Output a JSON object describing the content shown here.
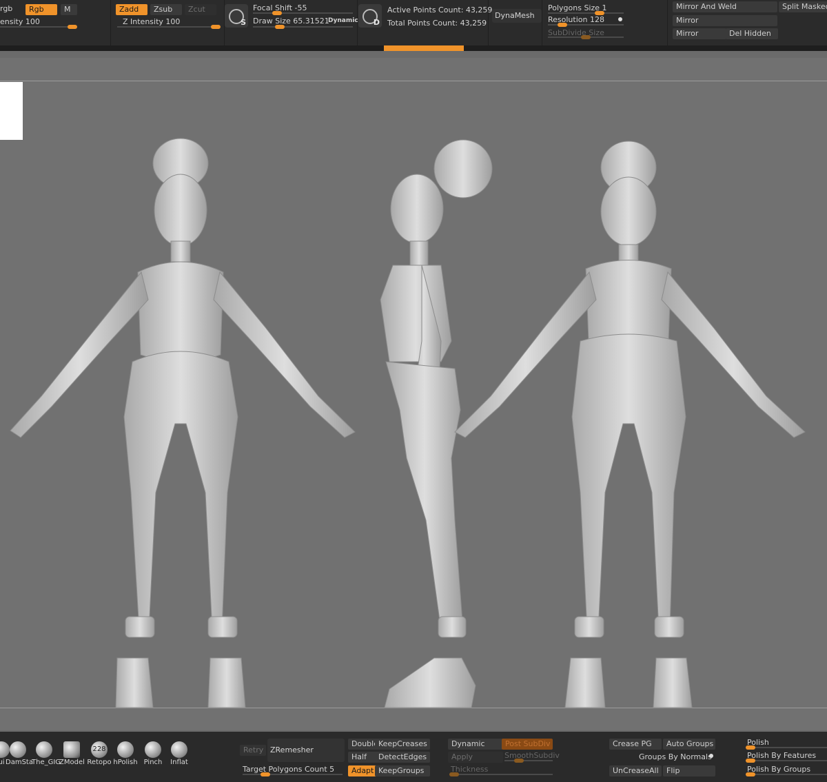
{
  "toolbar": {
    "rgb_label": "rgb",
    "rgb_toggle": "Rgb",
    "m_label": "M",
    "intensity": "ensity 100",
    "zadd": "Zadd",
    "zsub": "Zsub",
    "zcut": "Zcut",
    "z_intensity": "Z Intensity 100",
    "focal_shift": "Focal Shift -55",
    "draw_size": "Draw Size 65.31521",
    "dynamic_label": "Dynamic",
    "s_label": "S",
    "d_label": "D",
    "active_points": "Active Points Count: 43,259",
    "total_points": "Total Points Count: 43,259",
    "dynamesh": "DynaMesh",
    "polygons_size": "Polygons Size 1",
    "resolution": "Resolution 128",
    "subdivide_size": "SubDivide Size",
    "mirror_and_weld": "Mirror And Weld",
    "split_masked": "Split Masked",
    "mirror1": "Mirror",
    "mirror2": "Mirror",
    "del_hidden": "Del Hidden"
  },
  "brushes": [
    {
      "label": "ui"
    },
    {
      "label": "DamSta"
    },
    {
      "label": "The_GIG"
    },
    {
      "label": "ZModel"
    },
    {
      "label": "Retopo"
    },
    {
      "label": "hPolish"
    },
    {
      "label": "Pinch"
    },
    {
      "label": "Inflat"
    }
  ],
  "brush_badge": "228",
  "bottom": {
    "retry": "Retry",
    "zremesher": "ZRemesher",
    "target_polygons": "Target Polygons Count 5",
    "double": "Double",
    "half": "Half",
    "adapt": "Adapt",
    "keepcreases": "KeepCreases",
    "detectedges": "DetectEdges",
    "keepgroups": "KeepGroups",
    "dynamic": "Dynamic",
    "post_subdiv": "Post SubDiv",
    "apply": "Apply",
    "smoothsubdiv": "SmoothSubdiv",
    "thickness": "Thickness",
    "crease_pg": "Crease PG",
    "auto_groups": "Auto Groups",
    "groups_by_normals": "Groups By Normals",
    "uncreaseall": "UnCreaseAll",
    "flip": "Flip",
    "polish": "Polish",
    "polish_by_features": "Polish By Features",
    "polish_by_groups": "Polish By Groups"
  },
  "colors": {
    "accent": "#f0932a",
    "ui_dark": "#2b2b2b",
    "viewport": "#717171",
    "model": "#cfcfcf"
  }
}
